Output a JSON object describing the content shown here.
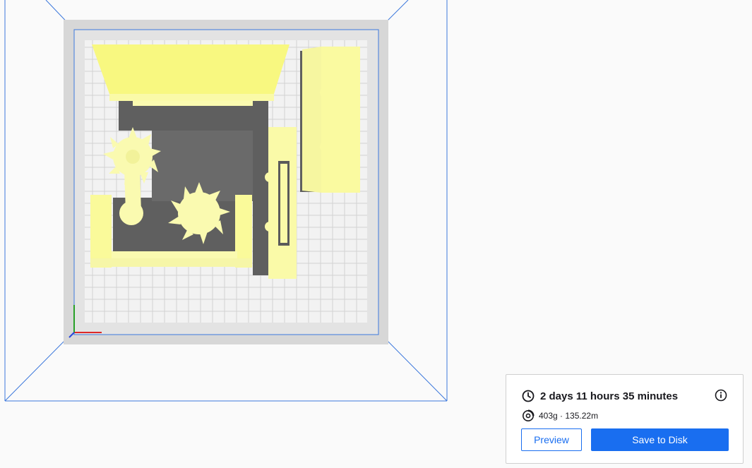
{
  "print_summary": {
    "print_time": "2 days 11 hours 35 minutes",
    "material": "403g · 135.22m",
    "preview_label": "Preview",
    "save_label": "Save to Disk"
  },
  "icons": {
    "time": "clock-icon",
    "info": "info-icon",
    "material": "filament-spool-icon"
  },
  "colors": {
    "accent": "#196ef0",
    "build_volume_outline": "#3c78dc",
    "model": "#fafaa0",
    "model_top": "#f8f88a",
    "model_shadow": "#5a5a5a",
    "x_axis": "#dc2828",
    "y_axis": "#28a028"
  }
}
